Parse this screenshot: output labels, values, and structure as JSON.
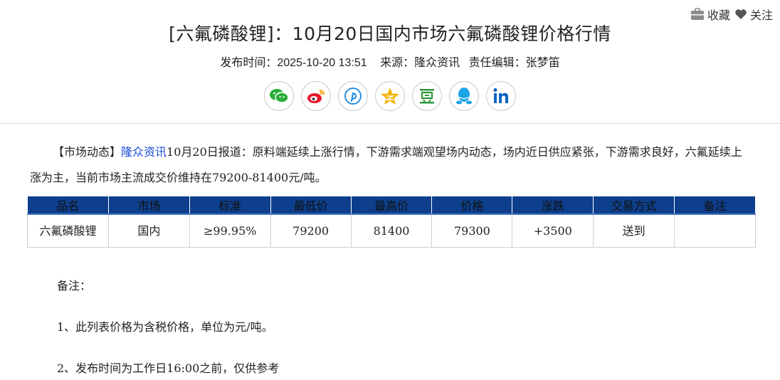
{
  "actions": {
    "collect": "收藏",
    "follow": "关注"
  },
  "article": {
    "title": "[六氟磷酸锂]：10月20日国内市场六氟磷酸锂价格行情",
    "publish_label": "发布时间：",
    "publish_time": "2025-10-20 13:51",
    "source_label": "来源：",
    "source": "隆众资讯",
    "editor_label": "责任编辑：",
    "editor": "张梦笛"
  },
  "share": [
    {
      "name": "wechat-icon",
      "color": "#2aae3a"
    },
    {
      "name": "weibo-icon",
      "color": "#e6162d"
    },
    {
      "name": "pinterest-icon",
      "color": "#2a8fe0"
    },
    {
      "name": "qzone-icon",
      "color": "#f5b400"
    },
    {
      "name": "douban-icon",
      "color": "#2e963d"
    },
    {
      "name": "qq-icon",
      "color": "#1ea3e8"
    },
    {
      "name": "linkedin-icon",
      "color": "#0a66c2"
    }
  ],
  "market": {
    "tag": "【市场动态】",
    "link": "隆众资讯",
    "text1": "10月20日报道：原料端延续上涨行情，下游需求端观望场内动态，场内近日供应紧张，下游需求良好，六氟延续上涨为主，当前市场主流成交价维持在79200-81400元/吨。"
  },
  "table": {
    "headers": [
      "品名",
      "市场",
      "标准",
      "最低价",
      "最高价",
      "价格",
      "涨跌",
      "交易方式",
      "备注"
    ],
    "row": [
      "六氟磷酸锂",
      "国内",
      "≥99.95%",
      "79200",
      "81400",
      "79300",
      "+3500",
      "送到",
      ""
    ]
  },
  "notes": {
    "title": "备注：",
    "n1": "1、此列表价格为含税价格，单位为元/吨。",
    "n2": "2、发布时间为工作日16:00之前，仅供参考"
  }
}
